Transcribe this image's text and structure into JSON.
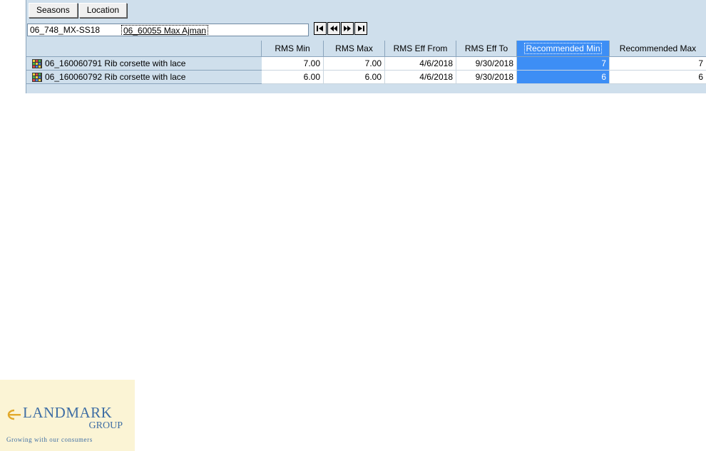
{
  "tabs": {
    "seasons_label": "Seasons",
    "location_label": "Location"
  },
  "selector": {
    "season": "06_748_MX-SS18",
    "location": "06_60055 Max Ajman"
  },
  "nav": {
    "icons": [
      "first-record-icon",
      "previous-record-icon",
      "next-record-icon",
      "last-record-icon"
    ]
  },
  "grid": {
    "columns": [
      "RMS Min",
      "RMS Max",
      "RMS Eff From",
      "RMS Eff To",
      "Recommended Min",
      "Recommended Max"
    ],
    "selected_column": "Recommended Min",
    "rows": [
      {
        "label": "06_160060791 Rib corsette with lace",
        "rms_min": "7.00",
        "rms_max": "7.00",
        "rms_eff_from": "4/6/2018",
        "rms_eff_to": "9/30/2018",
        "recommended_min": "7",
        "recommended_max": "7"
      },
      {
        "label": "06_160060792 Rib corsette with lace",
        "rms_min": "6.00",
        "rms_max": "6.00",
        "rms_eff_from": "4/6/2018",
        "rms_eff_to": "9/30/2018",
        "recommended_min": "6",
        "recommended_max": "6"
      }
    ]
  },
  "logo": {
    "name": "LANDMARK",
    "group": "GROUP",
    "tagline": "Growing with our consumers"
  },
  "colors": {
    "panel": "#cfdfec",
    "selection": "#3d8ef5",
    "logo_background": "#fbf4d5",
    "logo_text": "#3f6ea4",
    "logo_mark": "#e2a92b"
  }
}
